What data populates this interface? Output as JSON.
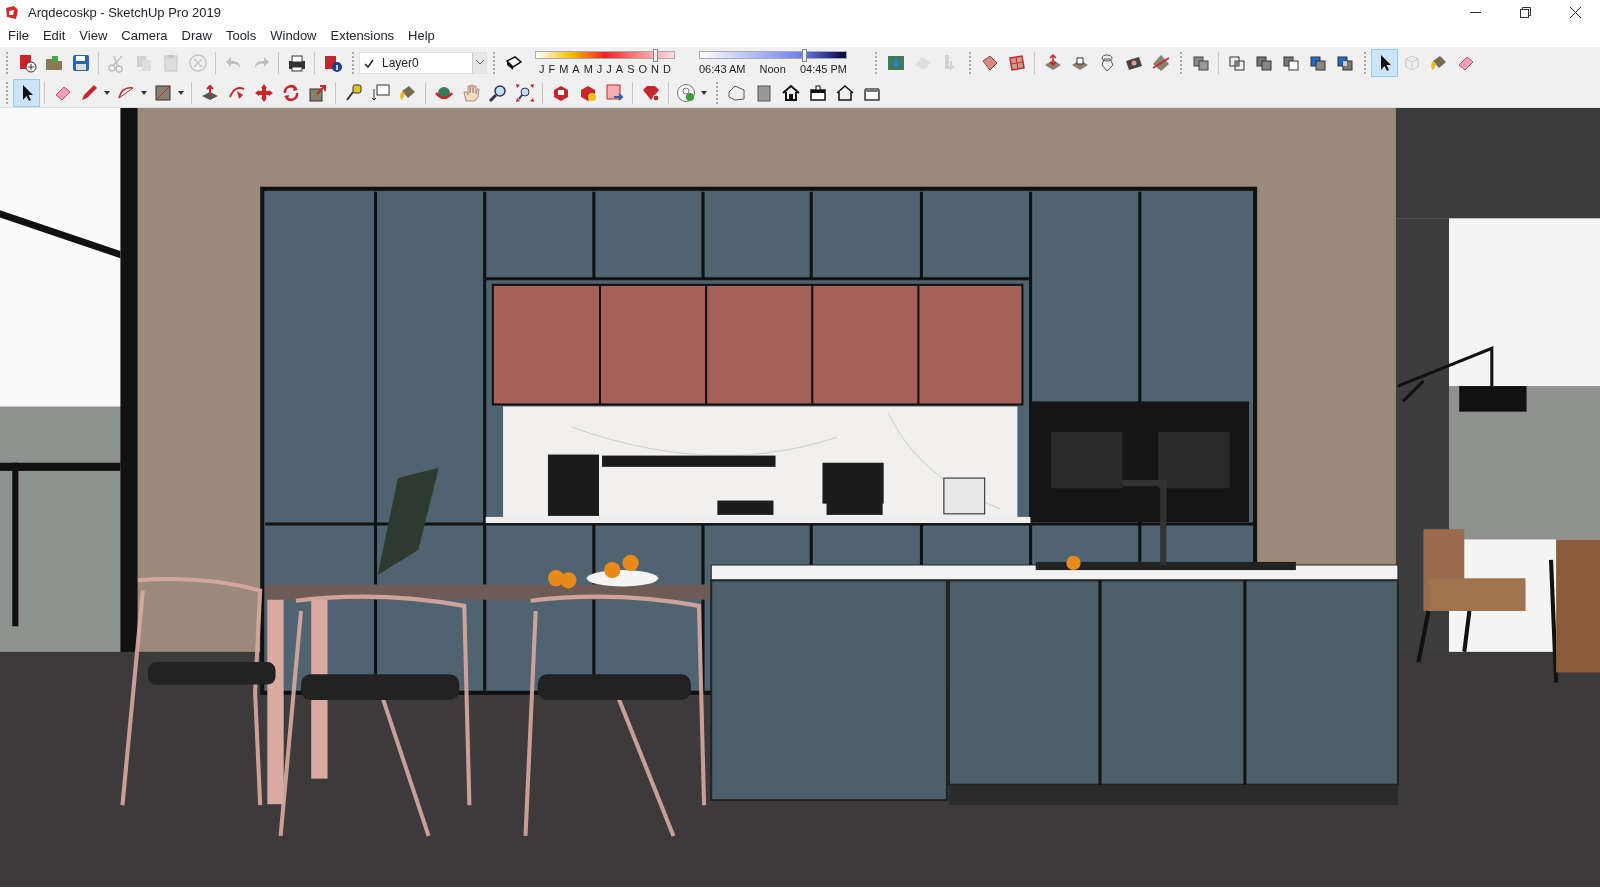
{
  "window": {
    "title": "Arqdecoskp - SketchUp Pro 2019"
  },
  "menu": [
    "File",
    "Edit",
    "View",
    "Camera",
    "Draw",
    "Tools",
    "Window",
    "Extensions",
    "Help"
  ],
  "toolbar_1": {
    "groups": [
      [
        {
          "disabled": false,
          "selected": false
        },
        {
          "disabled": false,
          "selected": false
        },
        {
          "disabled": false,
          "selected": false
        }
      ],
      [
        {
          "disabled": true,
          "selected": false
        },
        {
          "disabled": true,
          "selected": false
        },
        {
          "disabled": true,
          "selected": false
        },
        {
          "disabled": true,
          "selected": false
        }
      ],
      [
        {
          "disabled": true,
          "selected": false
        },
        {
          "disabled": true,
          "selected": false
        }
      ],
      [
        {
          "disabled": false,
          "selected": false
        }
      ],
      [
        {
          "disabled": false,
          "selected": false
        }
      ]
    ],
    "layer": {
      "checked": true,
      "value": "Layer0"
    },
    "shadows": {
      "months": [
        "J",
        "F",
        "M",
        "A",
        "M",
        "J",
        "J",
        "A",
        "S",
        "O",
        "N",
        "D"
      ],
      "date_slider": {
        "level": 0.87
      },
      "time_slider": {
        "level": 0.72
      },
      "time_start": "06:43 AM",
      "time_mid": "Noon",
      "time_end": "04:45 PM"
    },
    "groups_after": [
      [
        {
          "disabled": false,
          "selected": false
        },
        {
          "disabled": true,
          "selected": false
        },
        {
          "disabled": true,
          "selected": false
        }
      ],
      [
        {
          "disabled": false,
          "selected": false
        },
        {
          "disabled": false,
          "selected": false
        }
      ],
      [
        {
          "disabled": false,
          "selected": false
        },
        {
          "disabled": false,
          "selected": false
        },
        {
          "disabled": false,
          "selected": false
        },
        {
          "disabled": false,
          "selected": false
        },
        {
          "disabled": false,
          "selected": false
        }
      ],
      [
        {
          "disabled": false,
          "selected": false
        }
      ],
      [
        {
          "disabled": false,
          "selected": false
        },
        {
          "disabled": false,
          "selected": false
        },
        {
          "disabled": false,
          "selected": false
        },
        {
          "disabled": false,
          "selected": false
        },
        {
          "disabled": false,
          "selected": false
        }
      ],
      [
        {
          "disabled": false,
          "selected": true
        },
        {
          "disabled": true,
          "selected": false
        },
        {
          "disabled": false,
          "selected": false
        },
        {
          "disabled": false,
          "selected": false
        }
      ]
    ]
  },
  "toolbar_2": {
    "groups": [
      [
        {
          "disabled": false,
          "selected": true
        }
      ],
      [
        {
          "disabled": false,
          "selected": false
        },
        {
          "disabled": false,
          "selected": false
        },
        {
          "disabled": false,
          "selected": false
        },
        {
          "disabled": false,
          "selected": false
        }
      ],
      [
        {
          "disabled": false,
          "selected": false
        },
        {
          "disabled": false,
          "selected": false
        },
        {
          "disabled": false,
          "selected": false
        },
        {
          "disabled": false,
          "selected": false
        },
        {
          "disabled": false,
          "selected": false
        }
      ],
      [
        {
          "disabled": false,
          "selected": false
        },
        {
          "disabled": false,
          "selected": false
        },
        {
          "disabled": false,
          "selected": false
        }
      ],
      [
        {
          "disabled": false,
          "selected": false
        },
        {
          "disabled": false,
          "selected": false
        },
        {
          "disabled": false,
          "selected": false
        },
        {
          "disabled": false,
          "selected": false
        }
      ],
      [
        {
          "disabled": false,
          "selected": false
        },
        {
          "disabled": false,
          "selected": false
        },
        {
          "disabled": false,
          "selected": false
        }
      ],
      [
        {
          "disabled": false,
          "selected": false
        }
      ],
      [
        {
          "disabled": false,
          "selected": false
        }
      ],
      [
        {
          "disabled": false,
          "selected": false
        },
        {
          "disabled": false,
          "selected": false
        },
        {
          "disabled": false,
          "selected": false
        },
        {
          "disabled": false,
          "selected": false
        },
        {
          "disabled": false,
          "selected": false
        },
        {
          "disabled": false,
          "selected": false
        }
      ]
    ]
  }
}
